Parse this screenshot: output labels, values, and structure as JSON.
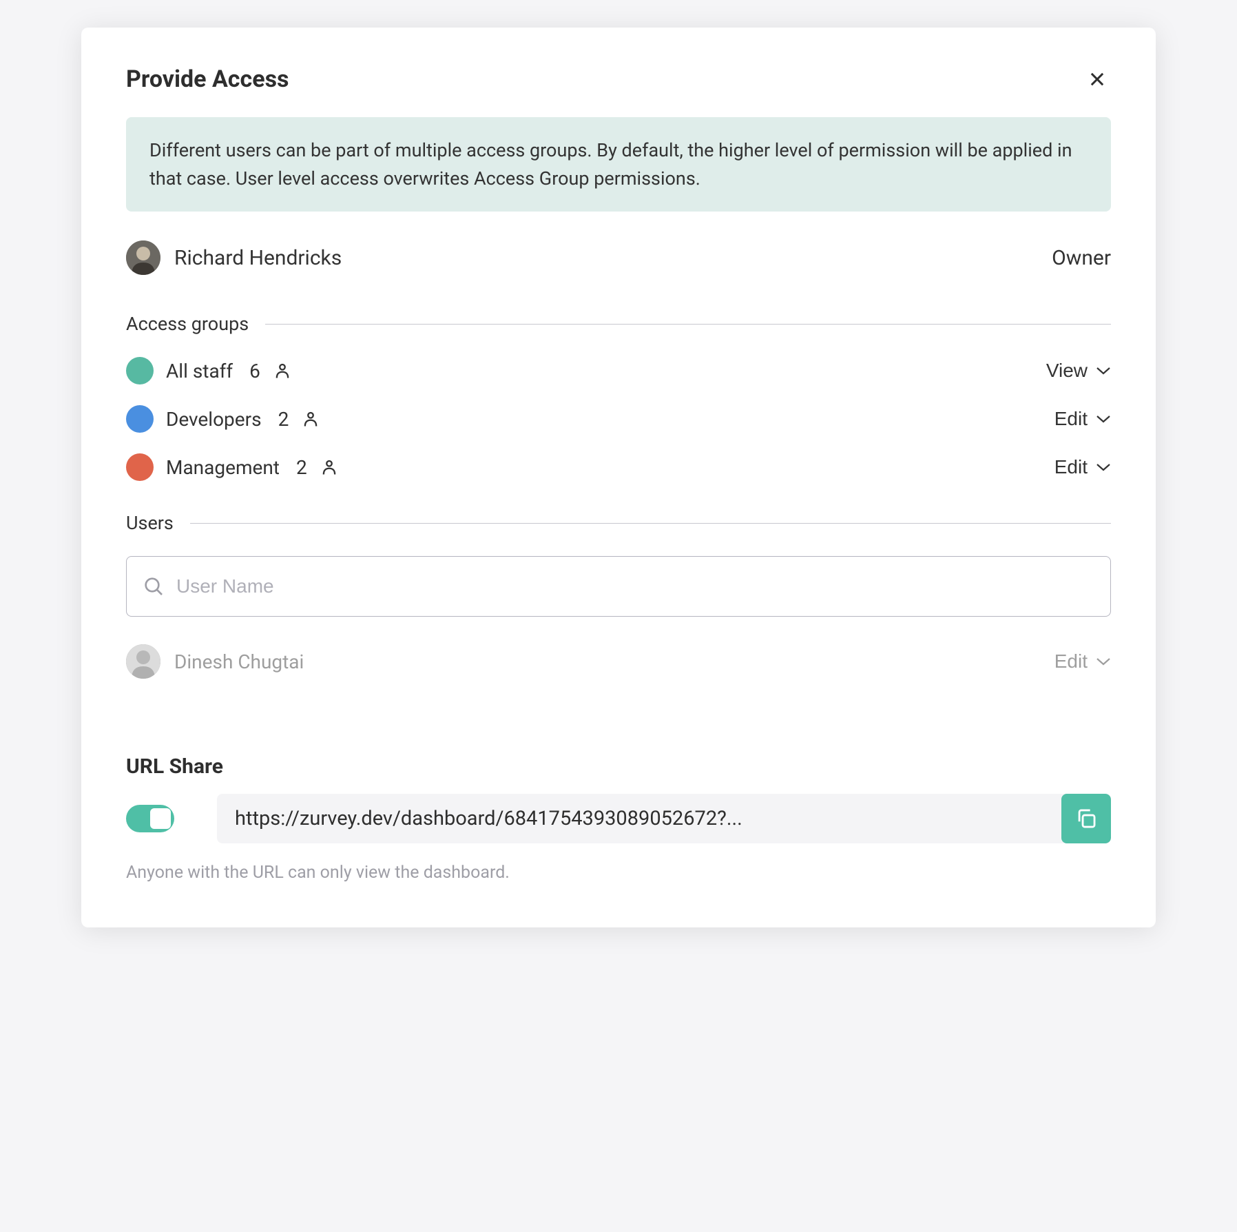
{
  "modal": {
    "title": "Provide Access",
    "info": "Different users can be part of multiple access groups. By default, the higher level of permission will be applied in that case. User level access overwrites Access Group permissions."
  },
  "owner": {
    "name": "Richard Hendricks",
    "role": "Owner"
  },
  "sections": {
    "access_groups_label": "Access groups",
    "users_label": "Users"
  },
  "groups": [
    {
      "name": "All staff",
      "count": "6",
      "color": "#57b9a2",
      "permission": "View"
    },
    {
      "name": "Developers",
      "count": "2",
      "color": "#4a8fe0",
      "permission": "Edit"
    },
    {
      "name": "Management",
      "count": "2",
      "color": "#e0644a",
      "permission": "Edit"
    }
  ],
  "search": {
    "placeholder": "User Name"
  },
  "users": [
    {
      "name": "Dinesh Chugtai",
      "permission": "Edit"
    }
  ],
  "url_share": {
    "title": "URL Share",
    "url": "https://zurvey.dev/dashboard/6841754393089052672?...",
    "note": "Anyone with the URL can only view the dashboard.",
    "enabled": true
  }
}
